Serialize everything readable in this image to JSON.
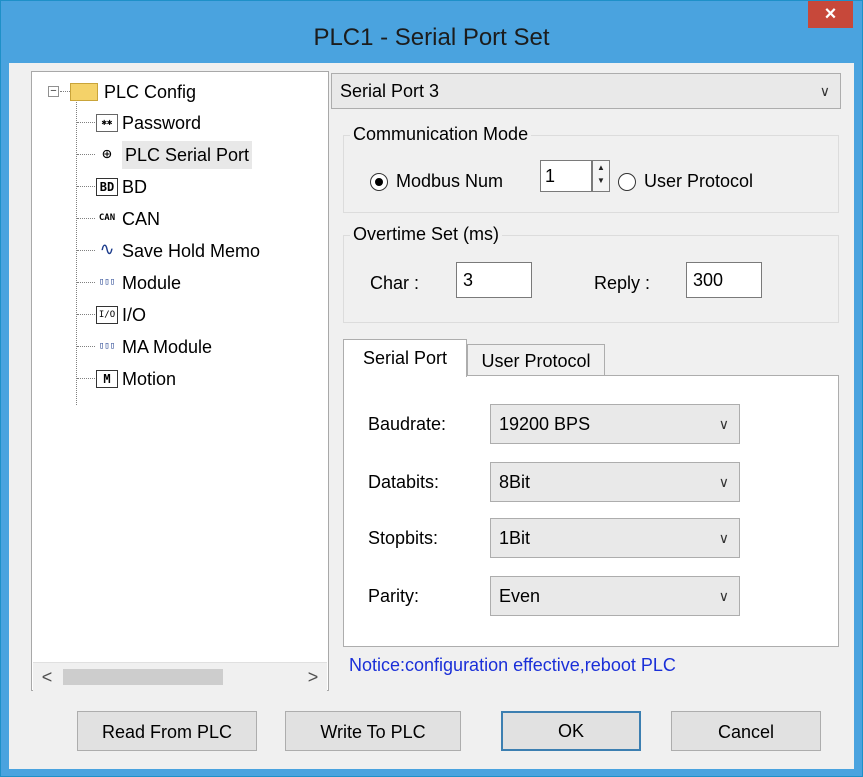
{
  "window": {
    "title": "PLC1 - Serial Port  Set",
    "close_glyph": "×"
  },
  "tree": {
    "root": {
      "label": "PLC Config",
      "expander": "−",
      "icon": "folder-icon"
    },
    "items": [
      {
        "label": "Password",
        "icon": "password-icon",
        "glyph": "✱✱"
      },
      {
        "label": "PLC Serial Port",
        "icon": "serial-port-icon",
        "glyph": "⊕"
      },
      {
        "label": "BD",
        "icon": "bd-icon",
        "glyph": "BD"
      },
      {
        "label": "CAN",
        "icon": "can-icon",
        "glyph": "CAN"
      },
      {
        "label": "Save Hold Memo",
        "icon": "waveform-icon",
        "glyph": "∿"
      },
      {
        "label": "Module",
        "icon": "module-icon",
        "glyph": "▯▯▯"
      },
      {
        "label": "I/O",
        "icon": "io-icon",
        "glyph": "I/O"
      },
      {
        "label": "MA Module",
        "icon": "ma-module-icon",
        "glyph": "▯▯▯"
      },
      {
        "label": "Motion",
        "icon": "motion-icon",
        "glyph": "M"
      }
    ],
    "selected_index": 1,
    "scroll_left": "<",
    "scroll_right": ">"
  },
  "port_select": {
    "value": "Serial Port 3",
    "chevron": "∨"
  },
  "comm_mode": {
    "title": "Communication Mode",
    "modbus_label": "Modbus Num",
    "modbus_value": "1",
    "user_protocol_label": "User Protocol",
    "selected": "Modbus Num"
  },
  "overtime": {
    "title": "Overtime Set (ms)",
    "char_label": "Char :",
    "char_value": "3",
    "reply_label": "Reply :",
    "reply_value": "300"
  },
  "tabs": {
    "serial_port": "Serial Port",
    "user_protocol": "User Protocol",
    "active": "Serial Port"
  },
  "serial_settings": {
    "baudrate_label": "Baudrate:",
    "baudrate_value": "19200 BPS",
    "databits_label": "Databits:",
    "databits_value": "8Bit",
    "stopbits_label": "Stopbits:",
    "stopbits_value": "1Bit",
    "parity_label": "Parity:",
    "parity_value": "Even",
    "chevron": "∨"
  },
  "notice": "Notice:configuration effective,reboot PLC",
  "buttons": {
    "read": "Read From PLC",
    "write": "Write To PLC",
    "ok": "OK",
    "cancel": "Cancel"
  },
  "colors": {
    "title_bar": "#4aa3df",
    "close": "#c7483a",
    "notice": "#1a2fd8",
    "default_button_border": "#3c7fb1"
  }
}
